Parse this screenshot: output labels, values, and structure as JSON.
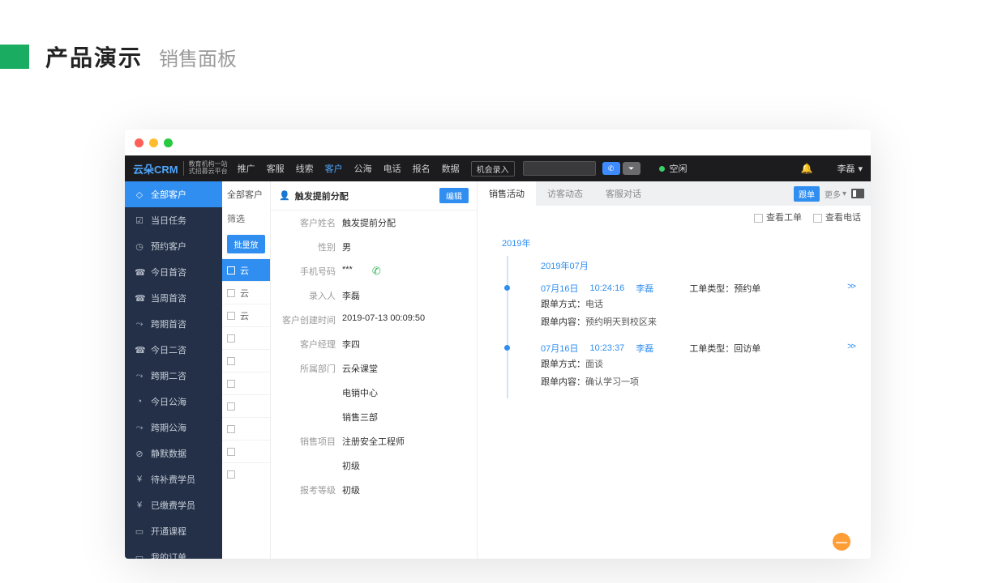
{
  "page": {
    "title_main": "产品演示",
    "title_sub": "销售面板"
  },
  "topbar": {
    "logo": "云朵CRM",
    "logo_sub1": "教育机构一站",
    "logo_sub2": "式招募云平台",
    "nav": [
      "推广",
      "客服",
      "线索",
      "客户",
      "公海",
      "电话",
      "报名",
      "数据"
    ],
    "nav_active": "客户",
    "pill": "机会录入",
    "status": "空闲",
    "user": "李磊"
  },
  "sidebar": {
    "items": [
      {
        "icon": "◇",
        "label": "全部客户",
        "active": true
      },
      {
        "icon": "☑",
        "label": "当日任务"
      },
      {
        "icon": "◷",
        "label": "预约客户"
      },
      {
        "icon": "☎",
        "label": "今日首咨"
      },
      {
        "icon": "☎",
        "label": "当周首咨"
      },
      {
        "icon": "⤳",
        "label": "跨期首咨"
      },
      {
        "icon": "☎",
        "label": "今日二咨"
      },
      {
        "icon": "⤳",
        "label": "跨期二咨"
      },
      {
        "icon": "◔",
        "label": "今日公海"
      },
      {
        "icon": "⤳",
        "label": "跨期公海"
      },
      {
        "icon": "⊘",
        "label": "静默数据"
      },
      {
        "icon": "¥",
        "label": "待补费学员"
      },
      {
        "icon": "¥",
        "label": "已缴费学员"
      },
      {
        "icon": "▭",
        "label": "开通课程"
      },
      {
        "icon": "▭",
        "label": "我的订单"
      }
    ]
  },
  "list": {
    "header": "全部客户",
    "filter": "筛选",
    "bulk": "批量放",
    "rows": [
      "云",
      "云",
      "云",
      "",
      "",
      "",
      "",
      "",
      "",
      ""
    ],
    "selected_index": 0
  },
  "detail": {
    "title": "触发提前分配",
    "edit": "编辑",
    "fields": [
      {
        "label": "客户姓名",
        "value": "触发提前分配"
      },
      {
        "label": "性别",
        "value": "男"
      },
      {
        "label": "手机号码",
        "value": "***",
        "phone": true
      },
      {
        "label": "录入人",
        "value": "李磊"
      },
      {
        "label": "客户创建时间",
        "value": "2019-07-13 00:09:50"
      },
      {
        "label": "客户经理",
        "value": "李四"
      },
      {
        "label": "所属部门",
        "value": "云朵课堂"
      },
      {
        "label": "",
        "value": "电销中心"
      },
      {
        "label": "",
        "value": "销售三部"
      },
      {
        "label": "销售项目",
        "value": "注册安全工程师"
      },
      {
        "label": "",
        "value": "初级"
      },
      {
        "label": "报考等级",
        "value": "初级"
      }
    ]
  },
  "right": {
    "tabs": [
      "销售活动",
      "访客动态",
      "客服对话"
    ],
    "active_tab": "销售活动",
    "tag": "跟单",
    "more": "更多",
    "chk1": "查看工单",
    "chk2": "查看电话",
    "year": "2019年",
    "month": "2019年07月",
    "entries": [
      {
        "date": "07月16日",
        "time": "10:24:16",
        "who": "李磊",
        "type": "工单类型：预约单",
        "lines": [
          {
            "k": "跟单方式：",
            "v": "电话"
          },
          {
            "k": "跟单内容：",
            "v": "预约明天到校区来"
          }
        ]
      },
      {
        "date": "07月16日",
        "time": "10:23:37",
        "who": "李磊",
        "type": "工单类型：回访单",
        "lines": [
          {
            "k": "跟单方式：",
            "v": "面谈"
          },
          {
            "k": "跟单内容：",
            "v": "确认学习一项"
          }
        ]
      }
    ],
    "expand": ">>"
  }
}
